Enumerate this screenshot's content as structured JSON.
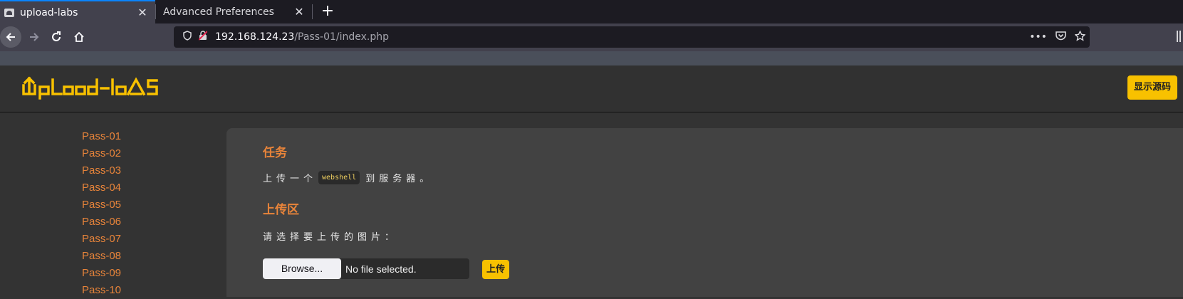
{
  "browser": {
    "tabs": [
      {
        "title": "upload-labs",
        "close": "✕"
      },
      {
        "title": "Advanced Preferences",
        "close": "✕"
      }
    ],
    "new_tab": "+",
    "url_host": "192.168.124.23",
    "url_path": "/Pass-01/index.php",
    "url_more": "•••"
  },
  "header": {
    "logo": "upload-labs",
    "show_source_label": "显示源码",
    "accent_color": "#f8c100"
  },
  "sidebar": {
    "items": [
      "Pass-01",
      "Pass-02",
      "Pass-03",
      "Pass-04",
      "Pass-05",
      "Pass-06",
      "Pass-07",
      "Pass-08",
      "Pass-09",
      "Pass-10"
    ]
  },
  "content": {
    "task_heading": "任务",
    "task_text_before": "上传一个",
    "task_code": "webshell",
    "task_text_after": "到服务器。",
    "upload_heading": "上传区",
    "choose_label": "请选择要上传的图片：",
    "browse_label": "Browse...",
    "no_file_label": "No file selected.",
    "submit_label": "上传"
  }
}
